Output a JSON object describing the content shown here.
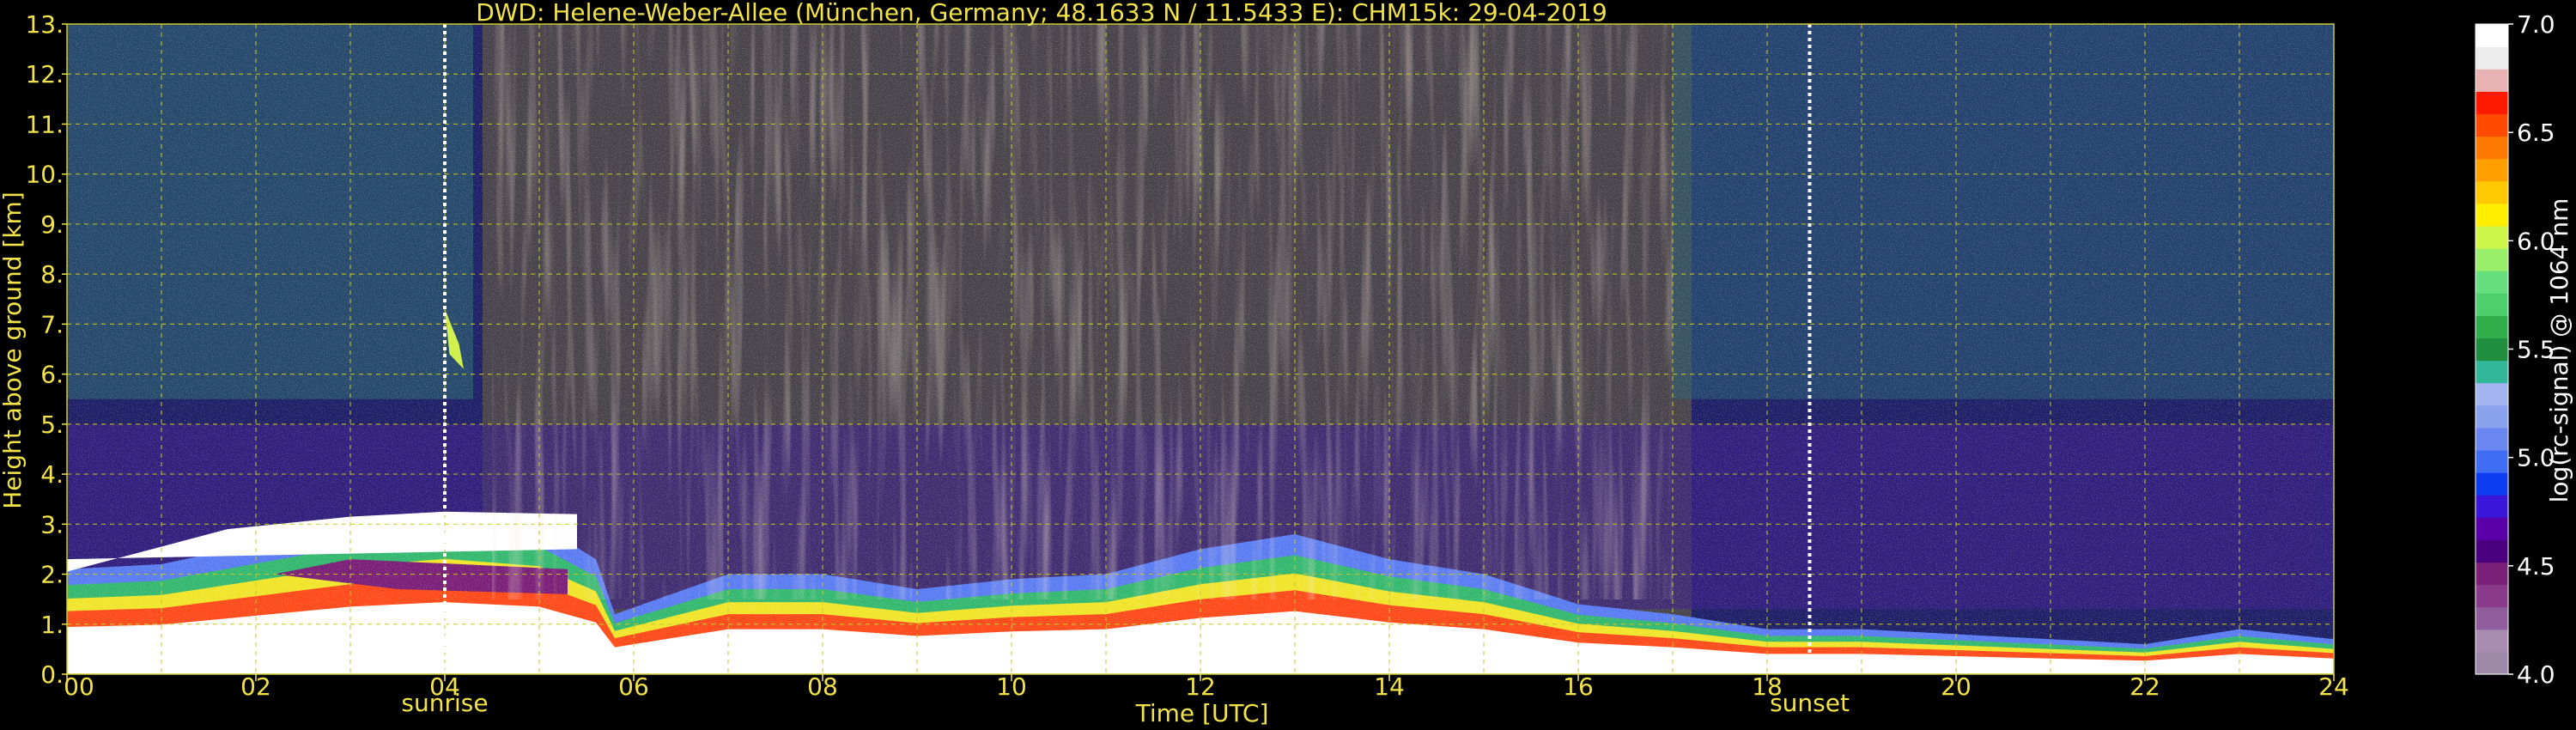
{
  "chart_data": {
    "type": "heatmap",
    "title": "DWD: Helene-Weber-Allee (München, Germany; 48.1633 N / 11.5433 E):    CHM15k: 29-04-2019",
    "xlabel": "Time [UTC]",
    "ylabel": "Height above ground [km]",
    "xlim": [
      0,
      24
    ],
    "ylim": [
      0,
      13
    ],
    "x_ticks": [
      "00",
      "02",
      "04",
      "06",
      "08",
      "10",
      "12",
      "14",
      "16",
      "18",
      "20",
      "22",
      "24"
    ],
    "y_ticks": [
      "0.",
      "1.",
      "2.",
      "3.",
      "4.",
      "5.",
      "6.",
      "7.",
      "8.",
      "9.",
      "10.",
      "11.",
      "12.",
      "13."
    ],
    "grid": true,
    "colorbar": {
      "label": "log(rc-signal) @ 1064 nm",
      "range": [
        4.0,
        7.0
      ],
      "ticks": [
        "4.0",
        "4.5",
        "5.0",
        "5.5",
        "6.0",
        "6.5",
        "7.0"
      ],
      "colors": [
        "#9c8aa8",
        "#a78cb0",
        "#8f5c9c",
        "#8a3a8a",
        "#7a1f78",
        "#4a007f",
        "#5a00a8",
        "#3a17d8",
        "#0c3cf0",
        "#3f6df4",
        "#6a86f0",
        "#8aa2ee",
        "#a3b4f0",
        "#33b79a",
        "#1f8f3f",
        "#2fae4a",
        "#4dd06c",
        "#66e07f",
        "#99ef6a",
        "#ccf54a",
        "#ffee00",
        "#ffc800",
        "#ffa000",
        "#ff7a00",
        "#ff4a00",
        "#ff1a00",
        "#e8b2b2",
        "#ececec",
        "#ffffff"
      ]
    },
    "markers": [
      {
        "label": "sunrise",
        "time": 4.0
      },
      {
        "label": "sunset",
        "time": 18.45
      }
    ],
    "boundary_layer_top_km": [
      [
        0.0,
        2.1
      ],
      [
        1.0,
        2.2
      ],
      [
        2.0,
        2.6
      ],
      [
        3.0,
        3.0
      ],
      [
        4.0,
        3.2
      ],
      [
        5.0,
        3.0
      ],
      [
        5.6,
        2.3
      ],
      [
        5.8,
        1.2
      ],
      [
        7.0,
        2.0
      ],
      [
        8.0,
        2.0
      ],
      [
        9.0,
        1.7
      ],
      [
        10.0,
        1.9
      ],
      [
        11.0,
        2.0
      ],
      [
        12.0,
        2.5
      ],
      [
        13.0,
        2.8
      ],
      [
        14.0,
        2.3
      ],
      [
        15.0,
        2.0
      ],
      [
        16.0,
        1.4
      ],
      [
        17.0,
        1.2
      ],
      [
        18.0,
        0.9
      ],
      [
        19.0,
        0.9
      ],
      [
        20.0,
        0.8
      ],
      [
        21.0,
        0.7
      ],
      [
        22.0,
        0.6
      ],
      [
        23.0,
        0.9
      ],
      [
        24.0,
        0.7
      ]
    ]
  }
}
